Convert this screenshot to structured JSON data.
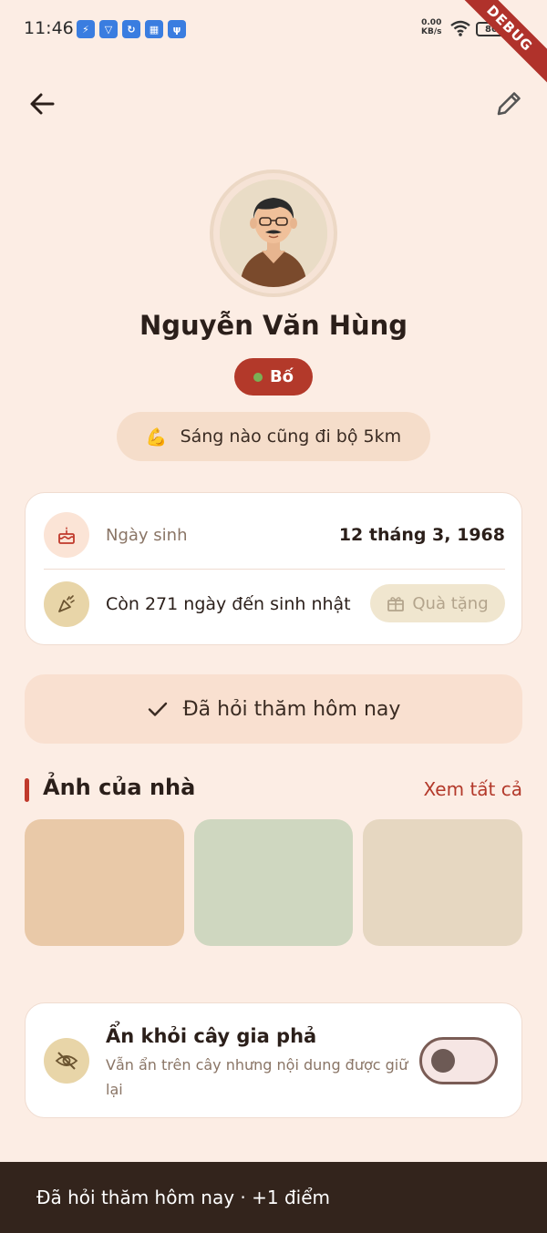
{
  "status_bar": {
    "time": "11:46",
    "net_speed_value": "0.00",
    "net_speed_unit": "KB/s",
    "battery": "80",
    "debug_label": "DEBUG"
  },
  "profile": {
    "name": "Nguyễn Văn Hùng",
    "role": "Bố",
    "quote_emoji": "💪",
    "quote": "Sáng nào cũng đi bộ 5km"
  },
  "info": {
    "birthday_label": "Ngày sinh",
    "birthday_value": "12 tháng 3, 1968",
    "countdown": "Còn 271 ngày đến sinh nhật",
    "gift_label": "Quà tặng"
  },
  "greet_button": "Đã hỏi thăm hôm nay",
  "photos_section": {
    "title": "Ảnh của nhà",
    "see_all": "Xem tất cả",
    "colors": [
      "#e9c9a8",
      "#cfd7c0",
      "#e6d7c1"
    ]
  },
  "hide_setting": {
    "title": "Ẩn khỏi cây gia phả",
    "subtitle": "Vẫn ẩn trên cây nhưng nội dung được giữ lại",
    "enabled": false
  },
  "snackbar": "Đã hỏi thăm hôm nay · +1 điểm",
  "colors": {
    "background": "#fcede4",
    "accent": "#b3392a",
    "snackbar": "#33241c"
  }
}
